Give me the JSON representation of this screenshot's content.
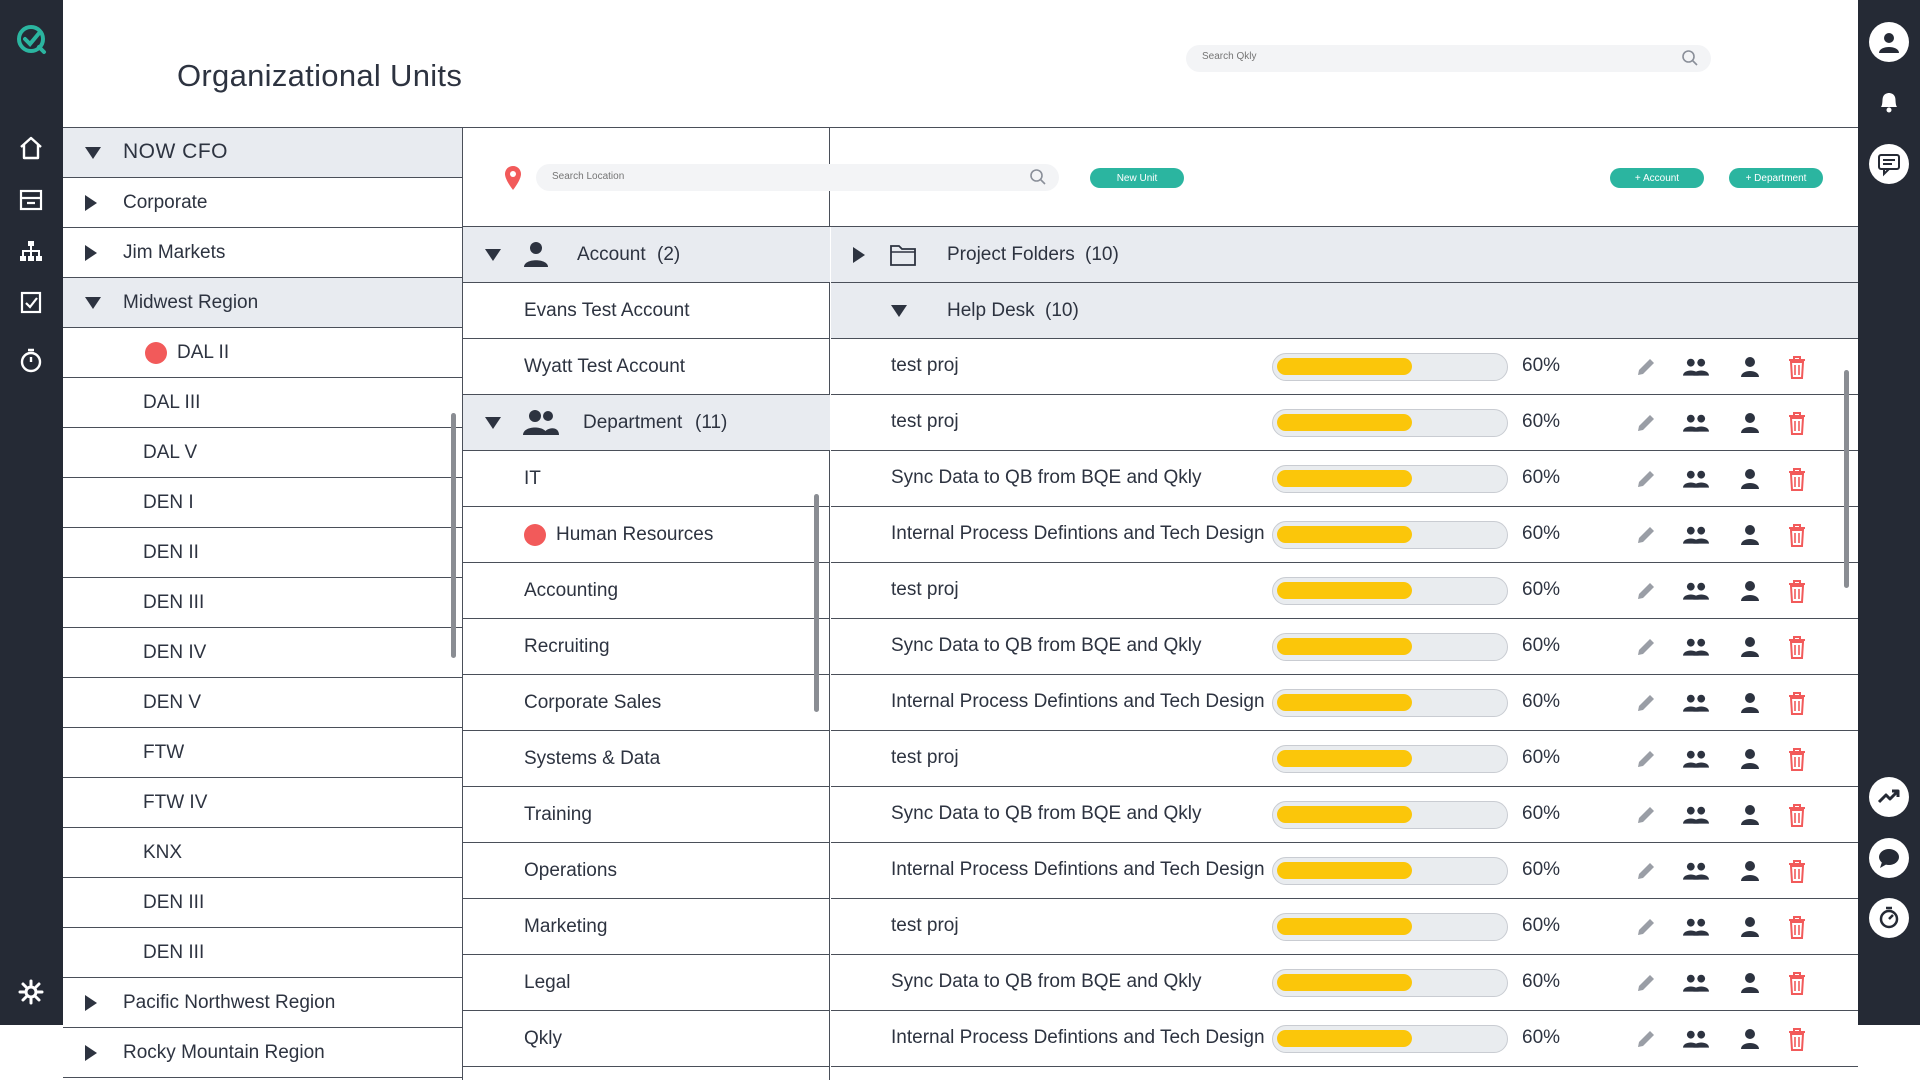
{
  "header": {
    "title": "Organizational Units",
    "search_placeholder": "Search Qkly"
  },
  "left_rail": {
    "items": [
      "logo-icon",
      "home-icon",
      "inbox-icon",
      "org-chart-icon",
      "checklist-icon",
      "timer-icon",
      "settings-icon"
    ]
  },
  "right_rail": {
    "items": [
      "user-avatar-icon",
      "bell-icon",
      "chat-icon",
      "trend-icon",
      "messages-icon",
      "stopwatch-icon"
    ]
  },
  "tree": {
    "root": "NOW CFO",
    "items": [
      {
        "label": "Corporate",
        "state": "collapsed"
      },
      {
        "label": "Jim Markets",
        "state": "collapsed"
      },
      {
        "label": "Midwest Region",
        "state": "expanded"
      },
      {
        "label": "DAL II",
        "dot": true
      },
      {
        "label": "DAL III"
      },
      {
        "label": "DAL V"
      },
      {
        "label": "DEN I"
      },
      {
        "label": "DEN II"
      },
      {
        "label": "DEN III"
      },
      {
        "label": "DEN IV"
      },
      {
        "label": "DEN V"
      },
      {
        "label": "FTW"
      },
      {
        "label": "FTW IV"
      },
      {
        "label": "KNX"
      },
      {
        "label": "DEN III"
      },
      {
        "label": "DEN III"
      },
      {
        "label": "Pacific Northwest Region",
        "state": "collapsed"
      },
      {
        "label": "Rocky Mountain Region",
        "state": "collapsed"
      }
    ]
  },
  "toolbar": {
    "location_placeholder": "Search Location",
    "new_unit": "New Unit",
    "add_account": "+ Account",
    "add_department": "+ Department"
  },
  "accounts": {
    "label": "Account",
    "count": "(2)",
    "items": [
      "Evans Test Account",
      "Wyatt Test Account"
    ]
  },
  "departments": {
    "label": "Department",
    "count": "(11)",
    "items": [
      "IT",
      "Human Resources",
      "Accounting",
      "Recruiting",
      "Corporate Sales",
      "Systems & Data",
      "Training",
      "Operations",
      "Marketing",
      "Legal",
      "Qkly"
    ]
  },
  "projects": {
    "folders_label": "Project Folders",
    "folders_count": "(10)",
    "group_label": "Help Desk",
    "group_count": "(10)",
    "rows": [
      {
        "name": "test proj",
        "progress": 0.6,
        "pct": "60%"
      },
      {
        "name": "test proj",
        "progress": 0.6,
        "pct": "60%"
      },
      {
        "name": "Sync Data to QB from BQE and Qkly",
        "progress": 0.6,
        "pct": "60%"
      },
      {
        "name": "Internal Process Defintions and Tech Design",
        "progress": 0.6,
        "pct": "60%"
      },
      {
        "name": "test proj",
        "progress": 0.6,
        "pct": "60%"
      },
      {
        "name": "Sync Data to QB from BQE and Qkly",
        "progress": 0.6,
        "pct": "60%"
      },
      {
        "name": "Internal Process Defintions and Tech Design",
        "progress": 0.6,
        "pct": "60%"
      },
      {
        "name": "test proj",
        "progress": 0.6,
        "pct": "60%"
      },
      {
        "name": "Sync Data to QB from BQE and Qkly",
        "progress": 0.6,
        "pct": "60%"
      },
      {
        "name": "Internal Process Defintions and Tech Design",
        "progress": 0.6,
        "pct": "60%"
      },
      {
        "name": "test proj",
        "progress": 0.6,
        "pct": "60%"
      },
      {
        "name": "Sync Data to QB from BQE and Qkly",
        "progress": 0.6,
        "pct": "60%"
      },
      {
        "name": "Internal Process Defintions and Tech Design",
        "progress": 0.6,
        "pct": "60%"
      }
    ]
  },
  "colors": {
    "rail": "#252a35",
    "accent": "#2bb5a0",
    "progress": "#fbc60a",
    "danger": "#f25a5a",
    "selected_row": "#e8ebf0"
  }
}
